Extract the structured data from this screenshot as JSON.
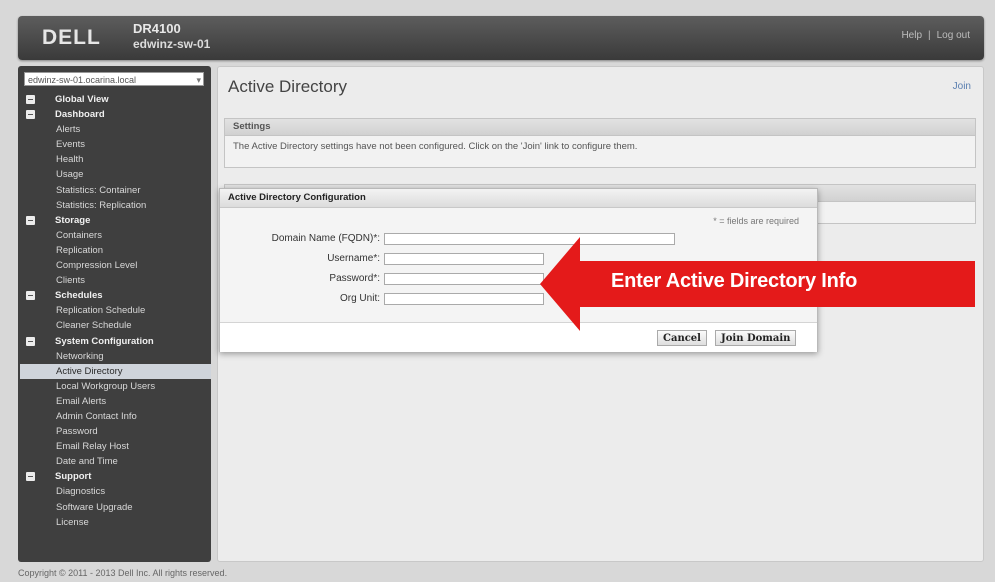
{
  "header": {
    "logo": "DELL",
    "product": "DR4100",
    "hostname": "edwinz-sw-01",
    "help_link": "Help",
    "separator": "|",
    "logout_link": "Log out"
  },
  "sidebar": {
    "host_select": "edwinz-sw-01.ocarina.local",
    "items": [
      {
        "label": "Global View",
        "type": "group"
      },
      {
        "label": "Dashboard",
        "type": "group"
      },
      {
        "label": "Alerts",
        "type": "item"
      },
      {
        "label": "Events",
        "type": "item"
      },
      {
        "label": "Health",
        "type": "item"
      },
      {
        "label": "Usage",
        "type": "item"
      },
      {
        "label": "Statistics: Container",
        "type": "item"
      },
      {
        "label": "Statistics: Replication",
        "type": "item"
      },
      {
        "label": "Storage",
        "type": "group"
      },
      {
        "label": "Containers",
        "type": "item"
      },
      {
        "label": "Replication",
        "type": "item"
      },
      {
        "label": "Compression Level",
        "type": "item"
      },
      {
        "label": "Clients",
        "type": "item"
      },
      {
        "label": "Schedules",
        "type": "group"
      },
      {
        "label": "Replication Schedule",
        "type": "item"
      },
      {
        "label": "Cleaner Schedule",
        "type": "item"
      },
      {
        "label": "System Configuration",
        "type": "group"
      },
      {
        "label": "Networking",
        "type": "item"
      },
      {
        "label": "Active Directory",
        "type": "item",
        "active": true
      },
      {
        "label": "Local Workgroup Users",
        "type": "item"
      },
      {
        "label": "Email Alerts",
        "type": "item"
      },
      {
        "label": "Admin Contact Info",
        "type": "item"
      },
      {
        "label": "Password",
        "type": "item"
      },
      {
        "label": "Email Relay Host",
        "type": "item"
      },
      {
        "label": "Date and Time",
        "type": "item"
      },
      {
        "label": "Support",
        "type": "group"
      },
      {
        "label": "Diagnostics",
        "type": "item"
      },
      {
        "label": "Software Upgrade",
        "type": "item"
      },
      {
        "label": "License",
        "type": "item"
      }
    ]
  },
  "main": {
    "title": "Active Directory",
    "join_link": "Join",
    "settings_header": "Settings",
    "settings_text": "The Active Directory settings have not been configured. Click on the 'Join' link to configure them."
  },
  "dialog": {
    "title": "Active Directory Configuration",
    "required_note": "* = fields are required",
    "fields": {
      "domain_label": "Domain Name (FQDN)*:",
      "domain_value": "",
      "username_label": "Username*:",
      "username_value": "",
      "password_label": "Password*:",
      "password_value": "",
      "org_unit_label": "Org Unit:",
      "org_unit_value": ""
    },
    "cancel_label": "Cancel",
    "join_label": "Join Domain"
  },
  "callout": {
    "text": "Enter Active Directory Info",
    "color": "#e41a1a"
  },
  "footer": {
    "copyright": "Copyright © 2011 - 2013 Dell Inc. All rights reserved."
  }
}
